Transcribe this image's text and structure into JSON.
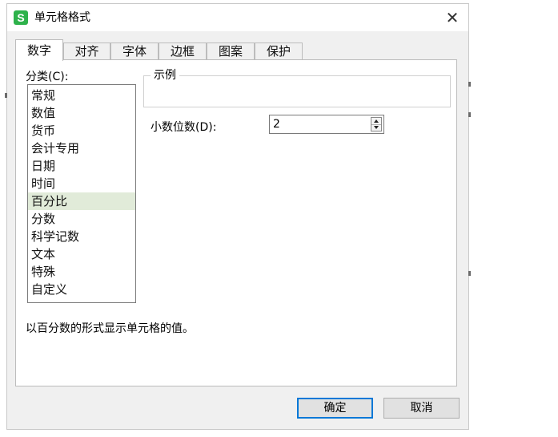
{
  "window": {
    "app_icon_letter": "S",
    "title": "单元格格式",
    "close_glyph": "✕"
  },
  "tabs": [
    {
      "label": "数字",
      "active": true
    },
    {
      "label": "对齐",
      "active": false
    },
    {
      "label": "字体",
      "active": false
    },
    {
      "label": "边框",
      "active": false
    },
    {
      "label": "图案",
      "active": false
    },
    {
      "label": "保护",
      "active": false
    }
  ],
  "category": {
    "label": "分类(C):",
    "items": [
      "常规",
      "数值",
      "货币",
      "会计专用",
      "日期",
      "时间",
      "百分比",
      "分数",
      "科学记数",
      "文本",
      "特殊",
      "自定义"
    ],
    "selected": "百分比"
  },
  "sample": {
    "legend": "示例"
  },
  "decimals": {
    "label": "小数位数(D):",
    "value": "2"
  },
  "description": "以百分数的形式显示单元格的值。",
  "buttons": {
    "ok": "确定",
    "cancel": "取消"
  },
  "colors": {
    "app_icon": "#2eb24b",
    "selected_row": "#e1ebd9",
    "default_button_border": "#0078d7"
  },
  "icons": {
    "app": "wps-spreadsheet-icon",
    "close": "close-icon",
    "spin": "spinner-arrows-icon"
  }
}
